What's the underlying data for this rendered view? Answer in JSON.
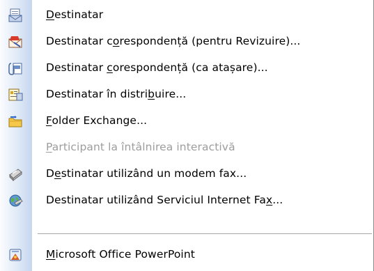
{
  "menu": {
    "items": [
      {
        "pre": "",
        "acc": "D",
        "post": "estinatar",
        "icon": "recipient-icon",
        "enabled": true
      },
      {
        "pre": "Destinatar c",
        "acc": "o",
        "post": "respondență (pentru Revizuire)...",
        "icon": "mail-review-icon",
        "enabled": true
      },
      {
        "pre": "Destinatar ",
        "acc": "c",
        "post": "orespondență (ca atașare)...",
        "icon": "mail-attachment-icon",
        "enabled": true
      },
      {
        "pre": "Destinatar în distri",
        "acc": "b",
        "post": "uire...",
        "icon": "routing-recipient-icon",
        "enabled": true
      },
      {
        "pre": "",
        "acc": "F",
        "post": "older Exchange...",
        "icon": "exchange-folder-icon",
        "enabled": true
      },
      {
        "pre": "",
        "acc": "P",
        "post": "articipant la întâlnirea interactivă",
        "icon": "",
        "enabled": false
      },
      {
        "pre": "D",
        "acc": "e",
        "post": "stinatar utilizând un modem fax...",
        "icon": "fax-modem-icon",
        "enabled": true
      },
      {
        "pre": "Destinatar utilizând Serviciul Internet Fa",
        "acc": "x",
        "post": "...",
        "icon": "internet-fax-icon",
        "enabled": true
      },
      {
        "pre": "",
        "acc": "M",
        "post": "icrosoft Office PowerPoint",
        "icon": "powerpoint-icon",
        "enabled": true
      }
    ]
  }
}
